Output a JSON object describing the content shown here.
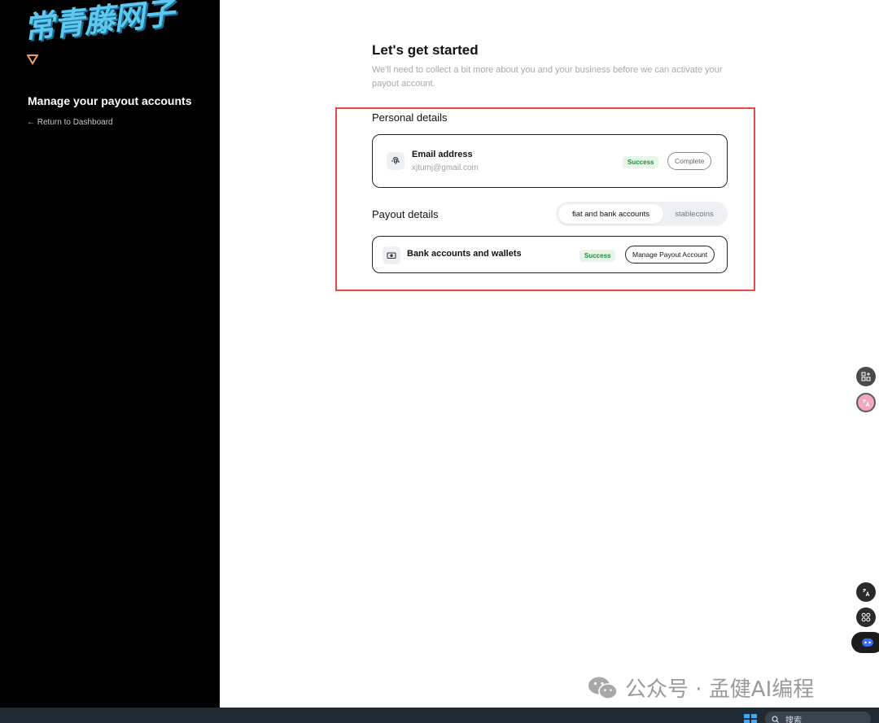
{
  "watermark_top": "常青藤网子",
  "sidebar": {
    "title": "Manage your payout accounts",
    "back_link": "← Return to Dashboard"
  },
  "header": {
    "title": "Let's get started",
    "subtitle": "We'll need to collect a bit more about you and your business before we can activate your payout account."
  },
  "personal": {
    "heading": "Personal details",
    "email_label": "Email address",
    "email_value": "xjtumj@gmail.com",
    "status": "Success",
    "action": "Complete",
    "icon": "fingerprint-icon"
  },
  "payout": {
    "heading": "Payout details",
    "tabs": [
      {
        "label": "fiat and bank accounts",
        "active": true
      },
      {
        "label": "stablecoins",
        "active": false
      }
    ],
    "bank_label": "Bank accounts and wallets",
    "status": "Success",
    "action": "Manage Payout Account",
    "icon": "wallet-icon"
  },
  "watermark_bottom": "公众号 · 孟健AI编程",
  "taskbar": {
    "search_placeholder": "搜索"
  },
  "colors": {
    "sidebar_bg": "#000000",
    "highlight": "#e5484d",
    "success_text": "#1f8a3a",
    "success_bg": "#e8f6ea",
    "watermark_cyan": "#5ec8ef"
  }
}
